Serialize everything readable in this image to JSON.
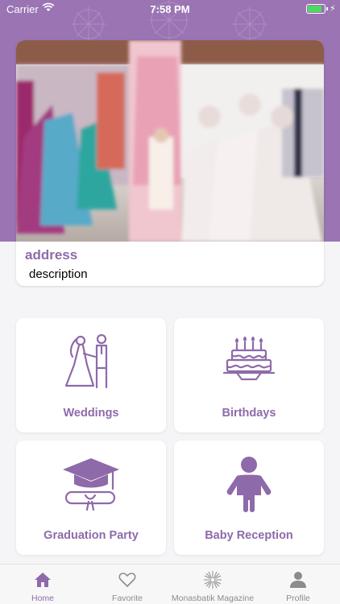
{
  "status_bar": {
    "carrier": "Carrier",
    "time": "7:58 PM",
    "battery_level": 0.85
  },
  "colors": {
    "brand_purple": "#9a74b3",
    "accent_text": "#8e6aaa",
    "inactive_tab": "#8c8c8c"
  },
  "featured": {
    "address": "address",
    "description": "description"
  },
  "categories": [
    {
      "label": "Weddings",
      "icon": "wedding-couple-icon"
    },
    {
      "label": "Birthdays",
      "icon": "birthday-cake-icon"
    },
    {
      "label": "Graduation Party",
      "icon": "graduation-cap-icon"
    },
    {
      "label": "Baby Reception",
      "icon": "baby-icon"
    }
  ],
  "tabbar": {
    "items": [
      {
        "label": "Home",
        "icon": "home-icon",
        "active": true
      },
      {
        "label": "Favorite",
        "icon": "heart-icon",
        "active": false
      },
      {
        "label": "Monasbatik Magazine",
        "icon": "sunburst-icon",
        "active": false
      },
      {
        "label": "Profile",
        "icon": "person-icon",
        "active": false
      }
    ]
  }
}
